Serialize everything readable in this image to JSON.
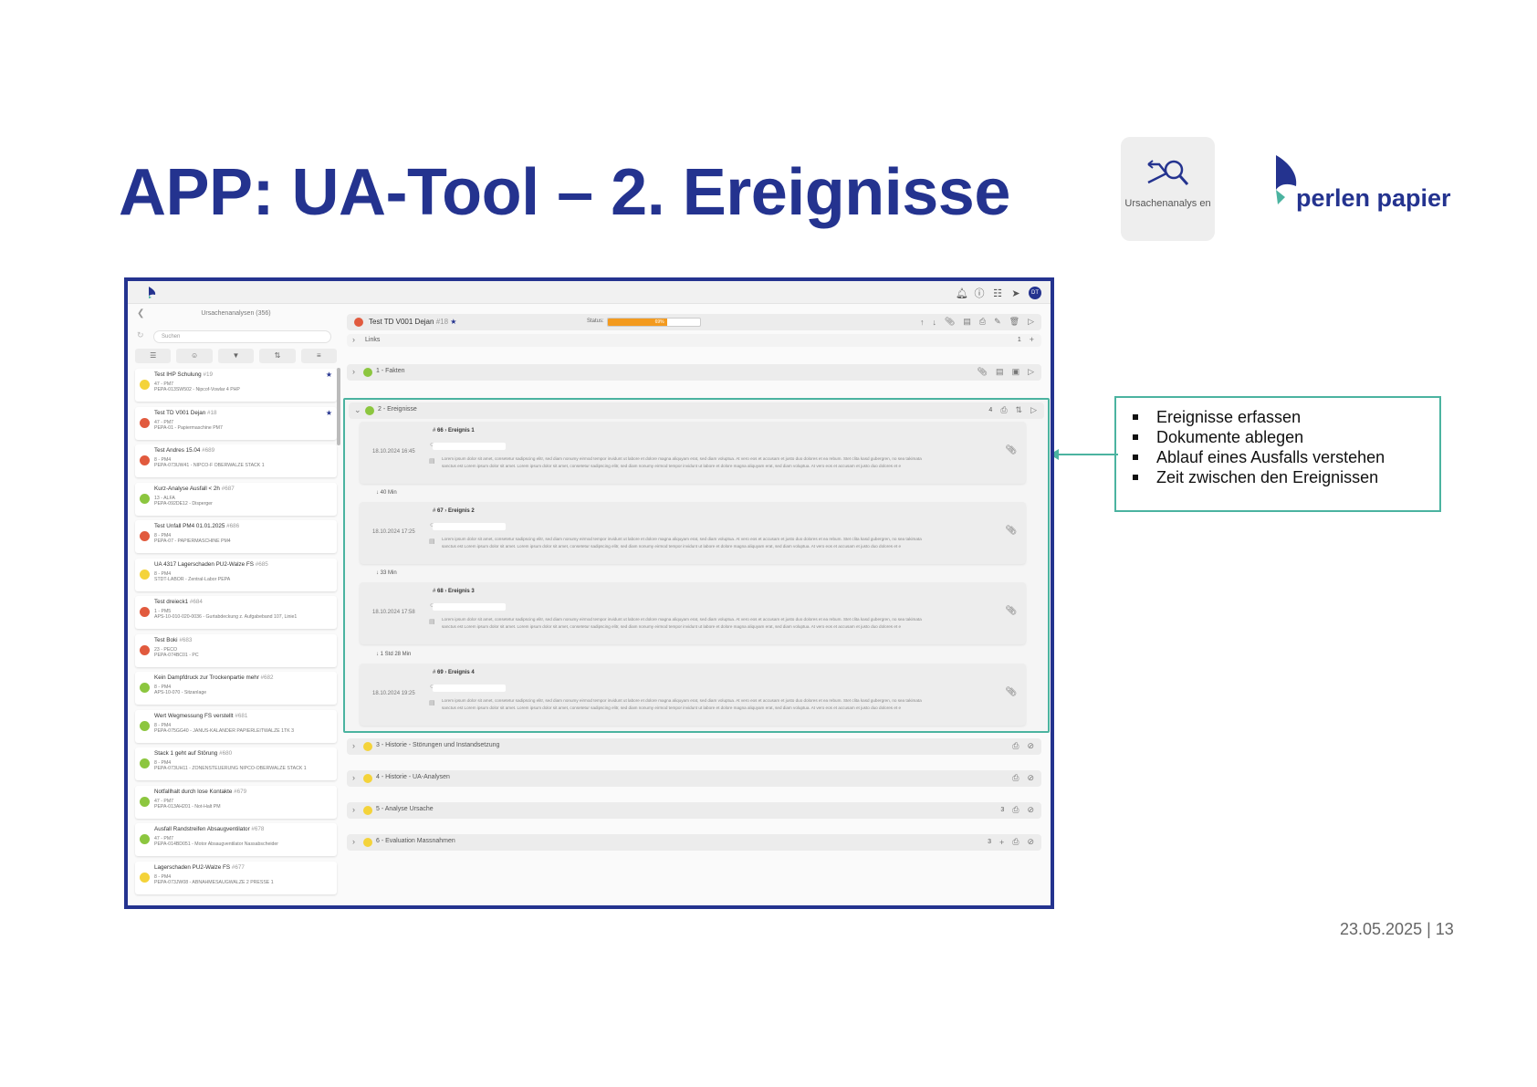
{
  "slide": {
    "title": "APP: UA-Tool – 2. Ereignisse",
    "footer": "23.05.2025 | 13",
    "app_tile_label": "Ursachenanalys en",
    "brand": "perlen papier",
    "callout": [
      "Ereignisse erfassen",
      "Dokumente ablegen",
      "Ablauf eines Ausfalls verstehen",
      "Zeit zwischen den Ereignissen"
    ],
    "colors": {
      "title": "#24338f",
      "accent": "#4bb3a0",
      "status": "#f39a1e"
    }
  },
  "app": {
    "list_title": "Ursachenanalysen (356)",
    "search_placeholder": "Suchen",
    "items": [
      {
        "title": "Test IHP Schulung",
        "id": "#19",
        "line1": "47 - PM7",
        "line2": "PEPA-013SW502 - Nipcof-Vowlar 4 PHP",
        "color": "yel",
        "star": "★"
      },
      {
        "title": "Test TD V001 Dejan",
        "id": "#18",
        "line1": "47 - PM7",
        "line2": "PEPA-01 - Papiermaschine PM7",
        "color": "red",
        "star": "★"
      },
      {
        "title": "Test Andres 15.04",
        "id": "#689",
        "line1": "8 - PM4",
        "line2": "PEPA-073UW41 - NIPCO-F OBERWALZE STACK 1",
        "color": "red",
        "star": ""
      },
      {
        "title": "Kurz-Analyse Ausfall < 2h",
        "id": "#687",
        "line1": "13 - ALFA",
        "line2": "PEPA-092DE12 - Disperger",
        "color": "grn",
        "star": ""
      },
      {
        "title": "Test Unfall PM4 01.01.2025",
        "id": "#686",
        "line1": "8 - PM4",
        "line2": "PEPA-07 - PAPIERMASCHINE PM4",
        "color": "red",
        "star": ""
      },
      {
        "title": "UA 4317 Lagerschaden PU2-Walze FS",
        "id": "#685",
        "line1": "8 - PM4",
        "line2": "STDT-LABOR - Zentral-Labor PEPA",
        "color": "yel",
        "star": ""
      },
      {
        "title": "Test dreieck1",
        "id": "#684",
        "line1": "1 - PM5",
        "line2": "APS-10-010-020-0036 - Gurtabdeckung z. Aufgabeband 107, Linie1",
        "color": "red",
        "star": ""
      },
      {
        "title": "Test Boki",
        "id": "#683",
        "line1": "23 - PECO",
        "line2": "PEPA-074BC01 - PC",
        "color": "red",
        "star": ""
      },
      {
        "title": "Kein Dampfdruck zur Trockenpartie mehr",
        "id": "#682",
        "line1": "8 - PM4",
        "line2": "APS-10-070 - Sitzanlage",
        "color": "grn",
        "star": ""
      },
      {
        "title": "Wert Wegmessung FS verstellt",
        "id": "#681",
        "line1": "8 - PM4",
        "line2": "PEPA-075GG40 - JANUS-KALANDER PAPIERLEITWALZE 1TK 3",
        "color": "grn",
        "star": ""
      },
      {
        "title": "Stack 1 geht auf Störung",
        "id": "#680",
        "line1": "8 - PM4",
        "line2": "PEPA-073UH11 - ZONENSTEUERUNG NIPCO-OBERWALZE STACK 1",
        "color": "grn",
        "star": ""
      },
      {
        "title": "Notfallhalt durch lose Kontakte",
        "id": "#679",
        "line1": "47 - PM7",
        "line2": "PEPA-013AH201 - Not-Halt PM",
        "color": "grn",
        "star": ""
      },
      {
        "title": "Ausfall Randstreifen Absaugventilator",
        "id": "#678",
        "line1": "47 - PM7",
        "line2": "PEPA-014BD051 - Motor Absaugventilator Nassabscheider",
        "color": "grn",
        "star": ""
      },
      {
        "title": "Lagerschaden PU2-Walze FS",
        "id": "#677",
        "line1": "8 - PM4",
        "line2": "PEPA-073JW08 - ABNAHMESAUGWALZE 2 PRESSE 1",
        "color": "yel",
        "star": ""
      }
    ],
    "header": {
      "title": "Test TD V001 Dejan",
      "id": "#18",
      "status_label": "Status:",
      "status_value": "69%",
      "progress": 0.64
    },
    "links": {
      "label": "Links",
      "count": "1"
    },
    "facts": {
      "label": "1 - Fakten"
    },
    "events_section": {
      "label": "2 - Ereignisse",
      "count": "4"
    },
    "events": [
      {
        "num": "66",
        "name": "Ereignis 1",
        "date": "18.10.2024 16:45"
      },
      {
        "num": "67",
        "name": "Ereignis 2",
        "date": "18.10.2024 17:25"
      },
      {
        "num": "68",
        "name": "Ereignis 3",
        "date": "18.10.2024 17:58"
      },
      {
        "num": "69",
        "name": "Ereignis 4",
        "date": "18.10.2024 19:25"
      }
    ],
    "gaps": [
      "↓ 40 Min",
      "↓ 33 Min",
      "↓ 1 Std 28 Min"
    ],
    "lorem": "Lorem ipsum dolor sit amet, consetetur sadipscing elitr, sed diam nonumy eirmod tempor invidunt ut labore et dolore magna aliquyam erat, sed diam voluptua. At vero eos et accusam et justo duo dolores et ea rebum. Stet clita kasd gubergren, no sea takimata sanctus est Lorem ipsum dolor sit amet. Lorem ipsum dolor sit amet, consetetur sadipscing elitr, sed diam nonumy eirmod tempor invidunt ut labore et dolore magna aliquyam erat, sed diam voluptua. At vero eos et accusam et justo duo dolores et e",
    "sections": [
      {
        "label": "3 - Historie - Störungen und Instandsetzung",
        "count": ""
      },
      {
        "label": "4 - Historie - UA-Analysen",
        "count": ""
      },
      {
        "label": "5 - Analyse Ursache",
        "count": "3"
      },
      {
        "label": "6 - Evaluation Massnahmen",
        "count": "3"
      }
    ]
  }
}
